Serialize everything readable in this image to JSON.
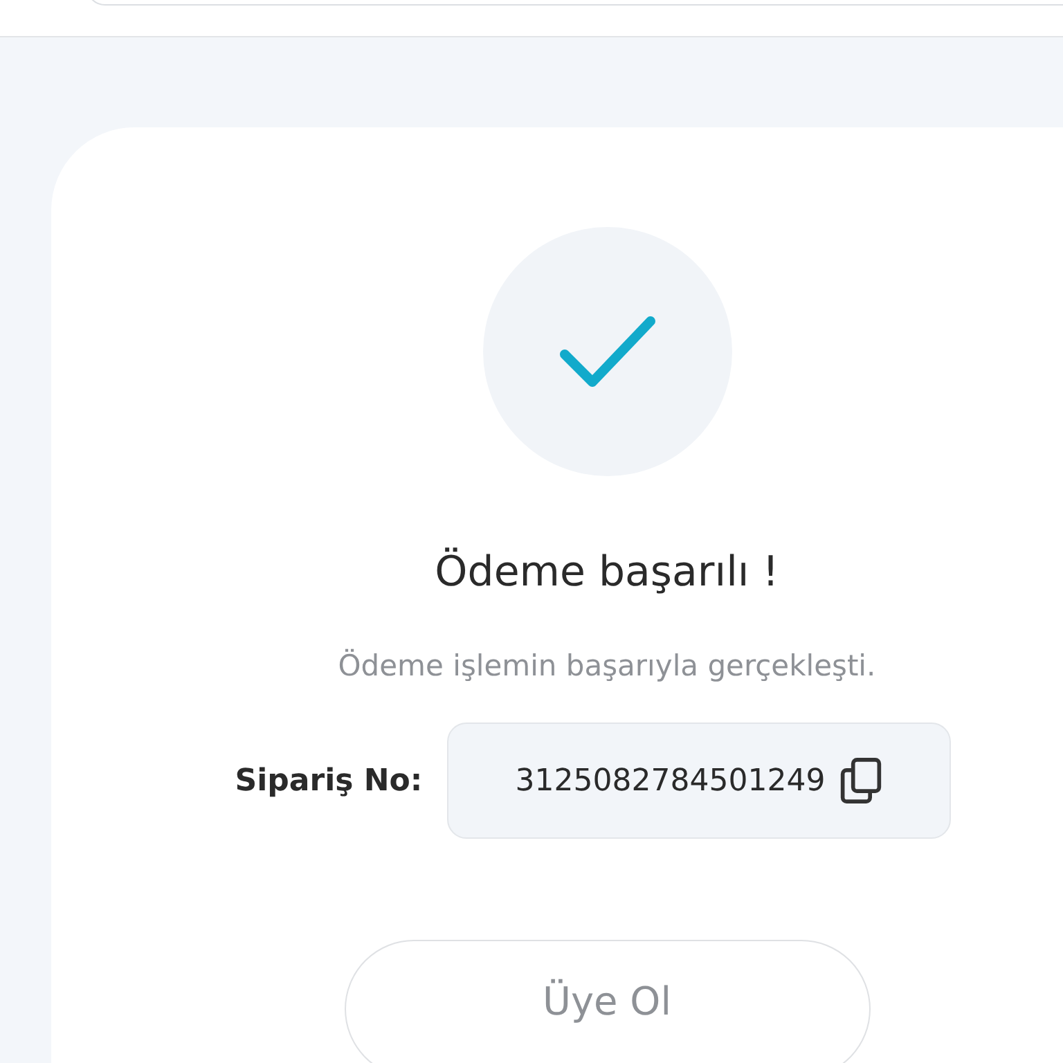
{
  "status": {
    "title": "Ödeme başarılı !",
    "message": "Ödeme işlemin başarıyla gerçekleşti.",
    "success": true
  },
  "order": {
    "label": "Sipariş No:",
    "number": "3125082784501249"
  },
  "buttons": [
    {
      "label": "Üye Ol"
    }
  ]
}
